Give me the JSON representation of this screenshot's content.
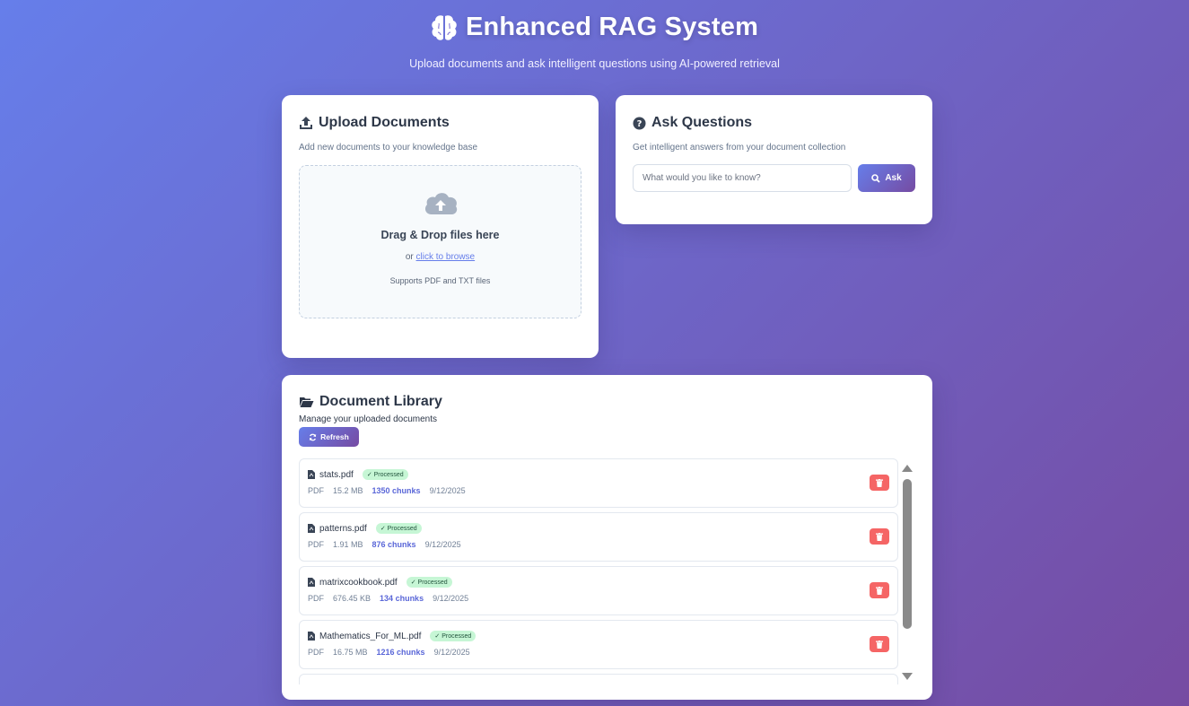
{
  "header": {
    "title": "Enhanced RAG System",
    "subtitle": "Upload documents and ask intelligent questions using AI-powered retrieval",
    "icon": "brain-icon"
  },
  "upload": {
    "title": "Upload Documents",
    "description": "Add new documents to your knowledge base",
    "dropzone": {
      "title": "Drag & Drop files here",
      "or": "or",
      "browse_link": "click to browse",
      "supports": "Supports PDF and TXT files"
    }
  },
  "ask": {
    "title": "Ask Questions",
    "description": "Get intelligent answers from your document collection",
    "placeholder": "What would you like to know?",
    "value": "",
    "button_label": "Ask"
  },
  "library": {
    "title": "Document Library",
    "description": "Manage your uploaded documents",
    "refresh_label": "Refresh",
    "documents": [
      {
        "name": "stats.pdf",
        "status": "✓ Processed",
        "type": "PDF",
        "size": "15.2 MB",
        "chunks": "1350 chunks",
        "date": "9/12/2025"
      },
      {
        "name": "patterns.pdf",
        "status": "✓ Processed",
        "type": "PDF",
        "size": "1.91 MB",
        "chunks": "876 chunks",
        "date": "9/12/2025"
      },
      {
        "name": "matrixcookbook.pdf",
        "status": "✓ Processed",
        "type": "PDF",
        "size": "676.45 KB",
        "chunks": "134 chunks",
        "date": "9/12/2025"
      },
      {
        "name": "Mathematics_For_ML.pdf",
        "status": "✓ Processed",
        "type": "PDF",
        "size": "16.75 MB",
        "chunks": "1216 chunks",
        "date": "9/12/2025"
      },
      {
        "name": "",
        "status": "",
        "type": "",
        "size": "",
        "chunks": "",
        "date": ""
      }
    ]
  },
  "colors": {
    "gradient_start": "#667eea",
    "gradient_end": "#764ba2",
    "badge_bg": "#c6f6d5",
    "delete": "#f56565",
    "chunks": "#5a67d8"
  }
}
